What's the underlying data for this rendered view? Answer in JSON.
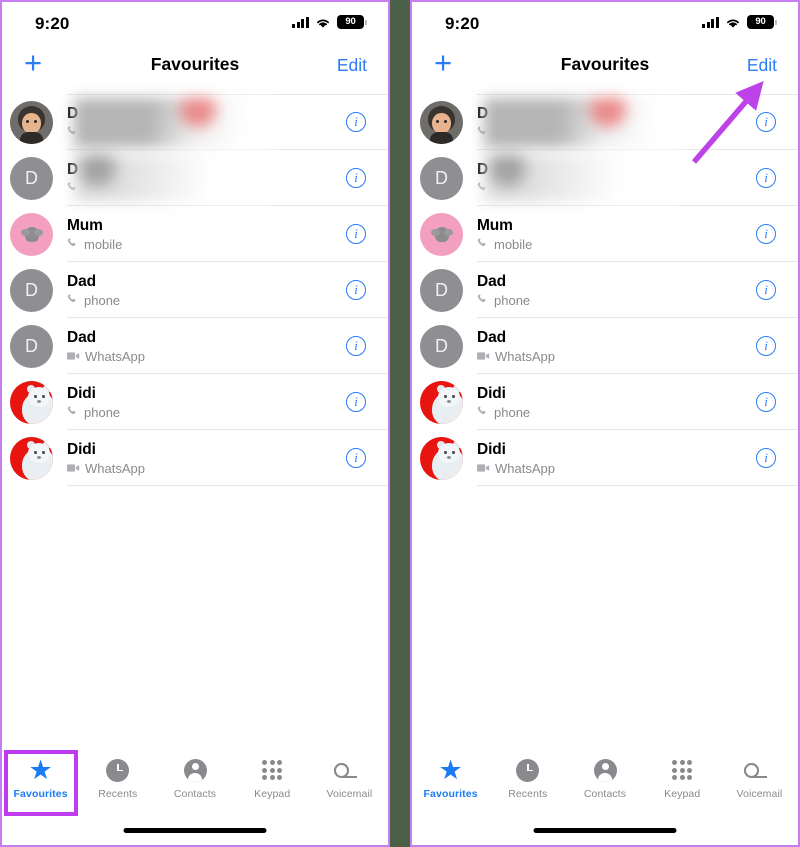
{
  "annotation": {
    "arrow_color": "#bd43e8",
    "highlight_color": "#c03cf0",
    "divider_color": "#4a6148",
    "panel_border_color": "#c77ef0",
    "arrow_target": "Edit"
  },
  "theme": {
    "accent_blue": "#2b7df6",
    "tab_active_blue": "#1a7bf2",
    "subtitle_grey": "#8a8a8e",
    "separator_grey": "#e6e6e8"
  },
  "status_bar": {
    "time": "9:20",
    "signal_icon": "cellular-signal-icon",
    "wifi_icon": "wifi-icon",
    "battery_icon": "battery-icon",
    "battery_level": "90"
  },
  "nav_bar": {
    "add_icon": "plus-icon",
    "add_label": "+",
    "title": "Favourites",
    "edit_label": "Edit"
  },
  "favourites": [
    {
      "name": "D",
      "name_redacted": true,
      "subtitle": "",
      "subtitle_icon": "phone-handset-icon",
      "avatar_type": "photo",
      "avatar_initial": "",
      "info_label": "i"
    },
    {
      "name": "D",
      "name_redacted": true,
      "subtitle": "",
      "subtitle_icon": "phone-handset-icon",
      "avatar_type": "grey",
      "avatar_initial": "D",
      "info_label": "i"
    },
    {
      "name": "Mum",
      "name_redacted": false,
      "subtitle": "mobile",
      "subtitle_icon": "phone-handset-icon",
      "avatar_type": "pink",
      "avatar_initial": "",
      "info_label": "i"
    },
    {
      "name": "Dad",
      "name_redacted": false,
      "subtitle": "phone",
      "subtitle_icon": "phone-handset-icon",
      "avatar_type": "grey",
      "avatar_initial": "D",
      "info_label": "i"
    },
    {
      "name": "Dad",
      "name_redacted": false,
      "subtitle": "WhatsApp",
      "subtitle_icon": "video-camera-icon",
      "avatar_type": "grey",
      "avatar_initial": "D",
      "info_label": "i"
    },
    {
      "name": "Didi",
      "name_redacted": false,
      "subtitle": "phone",
      "subtitle_icon": "phone-handset-icon",
      "avatar_type": "bear",
      "avatar_initial": "",
      "info_label": "i"
    },
    {
      "name": "Didi",
      "name_redacted": false,
      "subtitle": "WhatsApp",
      "subtitle_icon": "video-camera-icon",
      "avatar_type": "bear",
      "avatar_initial": "",
      "info_label": "i"
    }
  ],
  "tab_bar": {
    "active_index": 0,
    "items": [
      {
        "label": "Favourites",
        "icon": "star-icon"
      },
      {
        "label": "Recents",
        "icon": "clock-icon"
      },
      {
        "label": "Contacts",
        "icon": "person-circle-icon"
      },
      {
        "label": "Keypad",
        "icon": "keypad-grid-icon"
      },
      {
        "label": "Voicemail",
        "icon": "voicemail-icon"
      }
    ]
  }
}
